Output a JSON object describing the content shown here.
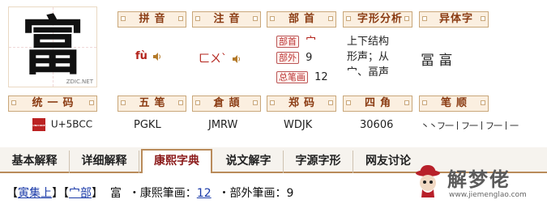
{
  "char": {
    "glyph": "富",
    "mark": "ZDIC.NET"
  },
  "headers": {
    "pinyin": "拼音",
    "zhuyin": "注音",
    "bushou": "部首",
    "zixing": "字形分析",
    "yiti": "异体字",
    "tongyi": "统一码",
    "wubi": "五笔",
    "cangjie": "倉頡",
    "zhengma": "郑码",
    "sijiao": "四角",
    "bishun": "笔顺"
  },
  "values": {
    "pinyin": "fù",
    "zhuyin": "ㄈㄨˋ",
    "bushou_label": "部首",
    "bushou": "宀",
    "buwai_label": "部外",
    "buwai": "9",
    "zongbihua_label": "总笔画",
    "zongbihua": "12",
    "zixing": "上下结构\n形声；从\n宀、畐声",
    "yiti": "冨 畗",
    "un_icon": "UNICODE",
    "tongyi": "U+5BCC",
    "wubi": "PGKL",
    "cangjie": "JMRW",
    "zhengma": "WDJK",
    "sijiao": "30606",
    "bishun": "丶丶フ一丨フ一丨フ一丨一"
  },
  "tabs": [
    "基本解释",
    "详细解释",
    "康熙字典",
    "说文解字",
    "字源字形",
    "网友讨论"
  ],
  "content": {
    "open1": "【",
    "ji": "寅集上",
    "close1": "】",
    "open2": "【",
    "bu": "宀部",
    "close2": "】",
    "zi": "富",
    "kx_label": "・康熙筆画：",
    "kx_val": "12",
    "bw_label": "・部外筆画：",
    "bw_val": "9"
  },
  "watermark": {
    "title": "解梦佬",
    "url": "www.jiemenglao.com"
  }
}
